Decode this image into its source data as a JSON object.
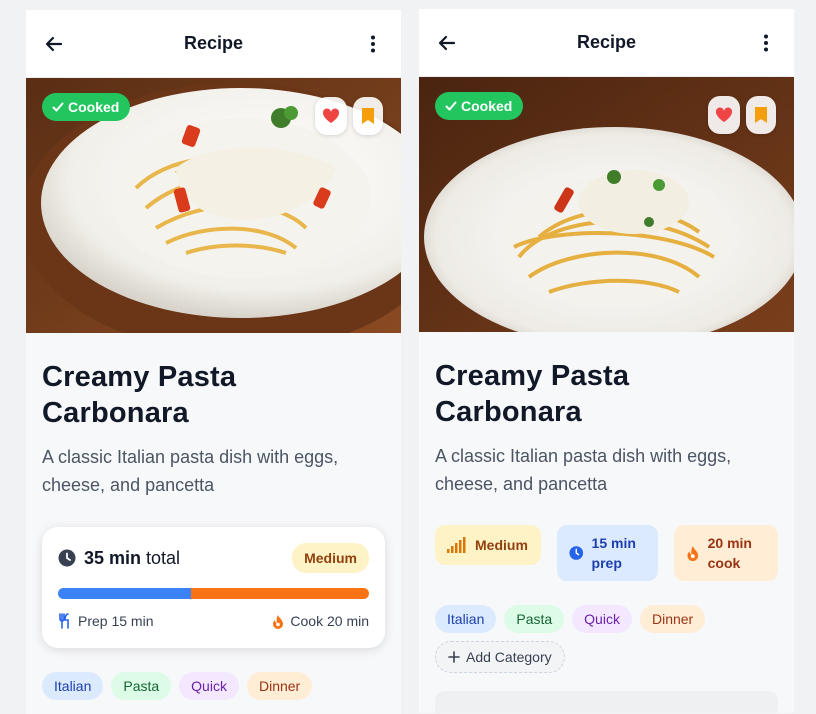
{
  "header": {
    "title": "Recipe"
  },
  "recipe": {
    "cooked_label": "Cooked",
    "title_line1": "Creamy Pasta",
    "title_line2": "Carbonara",
    "description": "A classic Italian pasta dish with eggs, cheese, and pancetta"
  },
  "time_card": {
    "total_value": "35 min",
    "total_suffix": " total",
    "difficulty": "Medium",
    "prep_label": "Prep 15 min",
    "cook_label": "Cook 20 min",
    "prep_fraction": 0.4286
  },
  "stats": {
    "difficulty": "Medium",
    "prep": "15 min prep",
    "cook": "20 min cook"
  },
  "tags": [
    "Italian",
    "Pasta",
    "Quick",
    "Dinner"
  ],
  "add_category_label": "Add Category",
  "colors": {
    "cooked_green": "#22c55e",
    "prep_blue": "#3b82f6",
    "cook_orange": "#f97316",
    "medium_bg": "#fef3c7",
    "favorite_red": "#ef4444",
    "bookmark_orange": "#f59e0b"
  },
  "icons": [
    "back-arrow-icon",
    "more-vertical-icon",
    "check-icon",
    "heart-icon",
    "bookmark-icon",
    "clock-icon",
    "utensils-icon",
    "flame-icon",
    "signal-bars-icon",
    "plus-icon"
  ]
}
